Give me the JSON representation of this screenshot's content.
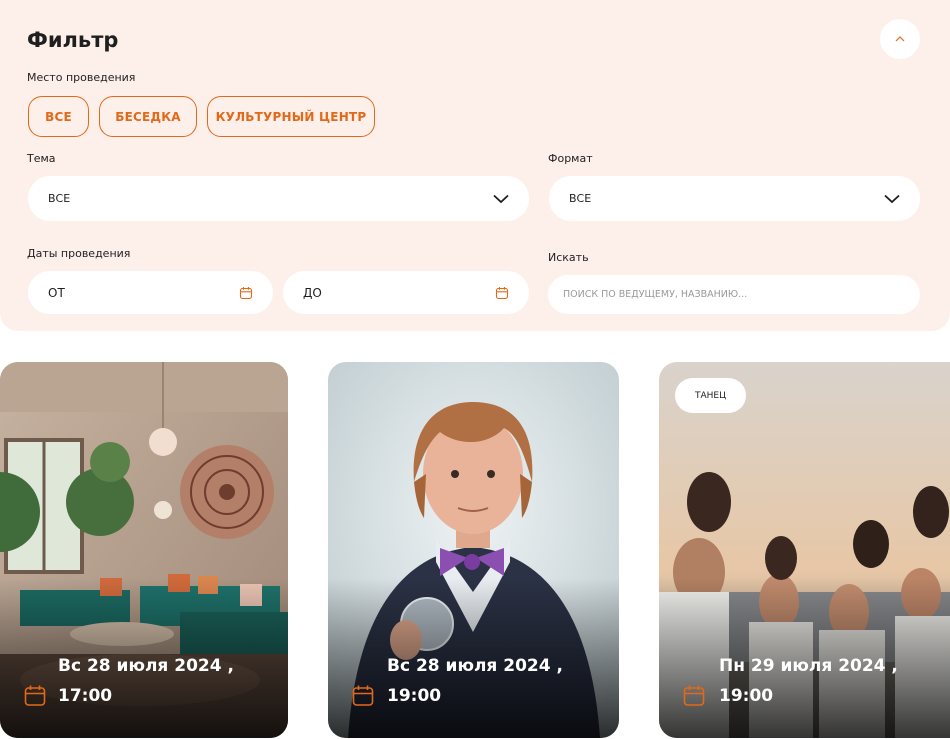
{
  "filter": {
    "title": "Фильтр",
    "venue_label": "Место проведения",
    "venues": [
      "ВСЕ",
      "БЕСЕДКА",
      "КУЛЬТУРНЫЙ ЦЕНТР"
    ],
    "topic_label": "Тема",
    "topic_value": "ВСЕ",
    "format_label": "Формат",
    "format_value": "ВСЕ",
    "dates_label": "Даты проведения",
    "date_from": "ОТ",
    "date_to": "ДО",
    "search_label": "Искать",
    "search_placeholder": "ПОИСК ПО ВЕДУЩЕМУ, НАЗВАНИЮ..."
  },
  "events": [
    {
      "date": "Вс 28 июля 2024 ,",
      "time": "17:00",
      "tag": ""
    },
    {
      "date": "Вс 28 июля 2024 ,",
      "time": "19:00",
      "tag": ""
    },
    {
      "date": "Пн 29 июля 2024 ,",
      "time": "19:00",
      "tag": "ТАНЕЦ"
    }
  ],
  "colors": {
    "accent": "#e2691a",
    "panel_bg": "#fdf0ea",
    "text": "#1f1f1f"
  },
  "icons": {
    "collapse": "chevron-up-icon",
    "dropdown": "chevron-down-icon",
    "date": "calendar-icon"
  }
}
